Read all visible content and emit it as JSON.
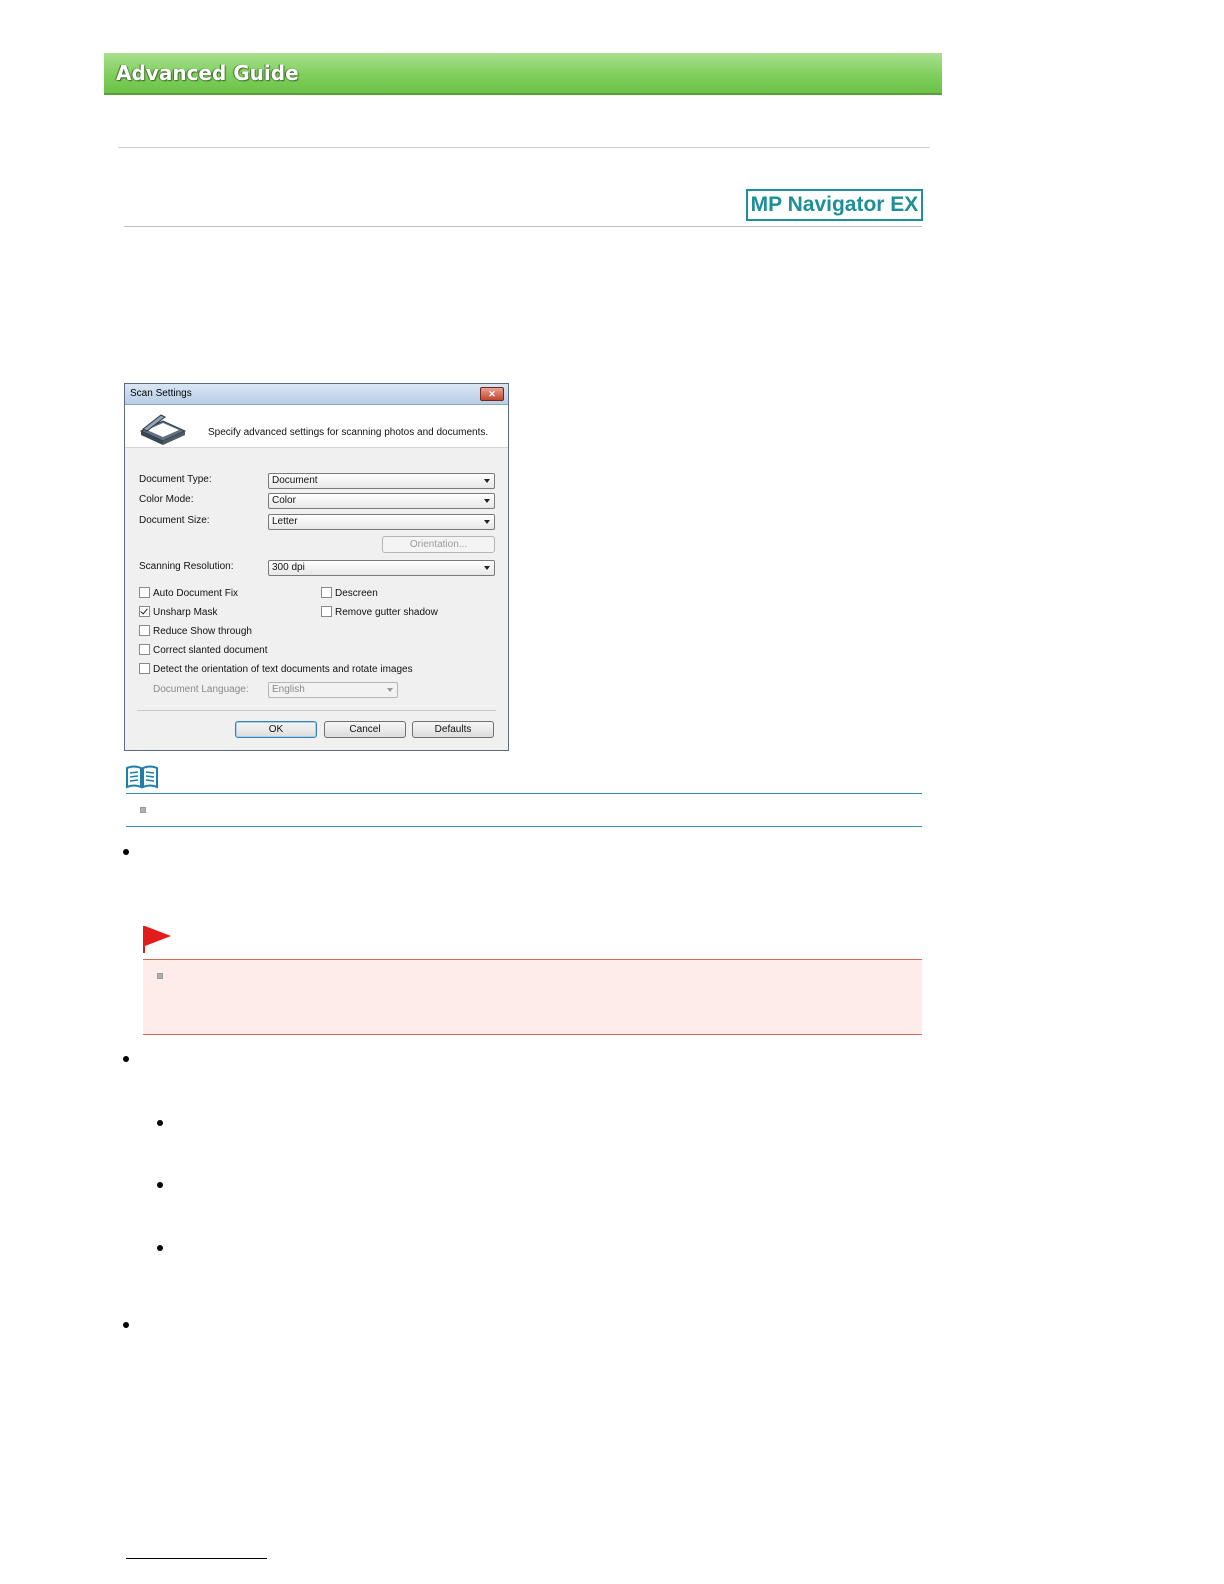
{
  "header": {
    "title": "Advanced Guide",
    "app_logo": "MP Navigator EX"
  },
  "dialog": {
    "title": "Scan Settings",
    "close_icon": "close-icon",
    "description": "Specify advanced settings for scanning photos and documents.",
    "fields": {
      "document_type": {
        "label": "Document Type:",
        "value": "Document"
      },
      "color_mode": {
        "label": "Color Mode:",
        "value": "Color"
      },
      "document_size": {
        "label": "Document Size:",
        "value": "Letter"
      },
      "scanning_resolution": {
        "label": "Scanning Resolution:",
        "value": "300 dpi"
      },
      "document_language": {
        "label": "Document Language:",
        "value": "English"
      }
    },
    "orientation_button": "Orientation...",
    "checkboxes": {
      "auto_document_fix": {
        "label": "Auto Document Fix",
        "checked": false
      },
      "descreen": {
        "label": "Descreen",
        "checked": false
      },
      "unsharp_mask": {
        "label": "Unsharp Mask",
        "checked": true
      },
      "remove_gutter_shadow": {
        "label": "Remove gutter shadow",
        "checked": false
      },
      "reduce_show_through": {
        "label": "Reduce Show through",
        "checked": false
      },
      "correct_slanted": {
        "label": "Correct slanted document",
        "checked": false
      },
      "detect_orientation": {
        "label": "Detect the orientation of text documents and rotate images",
        "checked": false
      }
    },
    "buttons": {
      "ok": "OK",
      "cancel": "Cancel",
      "defaults": "Defaults"
    }
  },
  "colors": {
    "banner_green": "#7fcf5c",
    "logo_teal": "#1e8f9a",
    "note_blue": "#3a8bb0",
    "important_red": "#e31b1b",
    "important_bg": "#fdecea"
  },
  "icons": {
    "note": "book-icon",
    "important": "red-flag-icon",
    "scanner": "scanner-icon"
  }
}
